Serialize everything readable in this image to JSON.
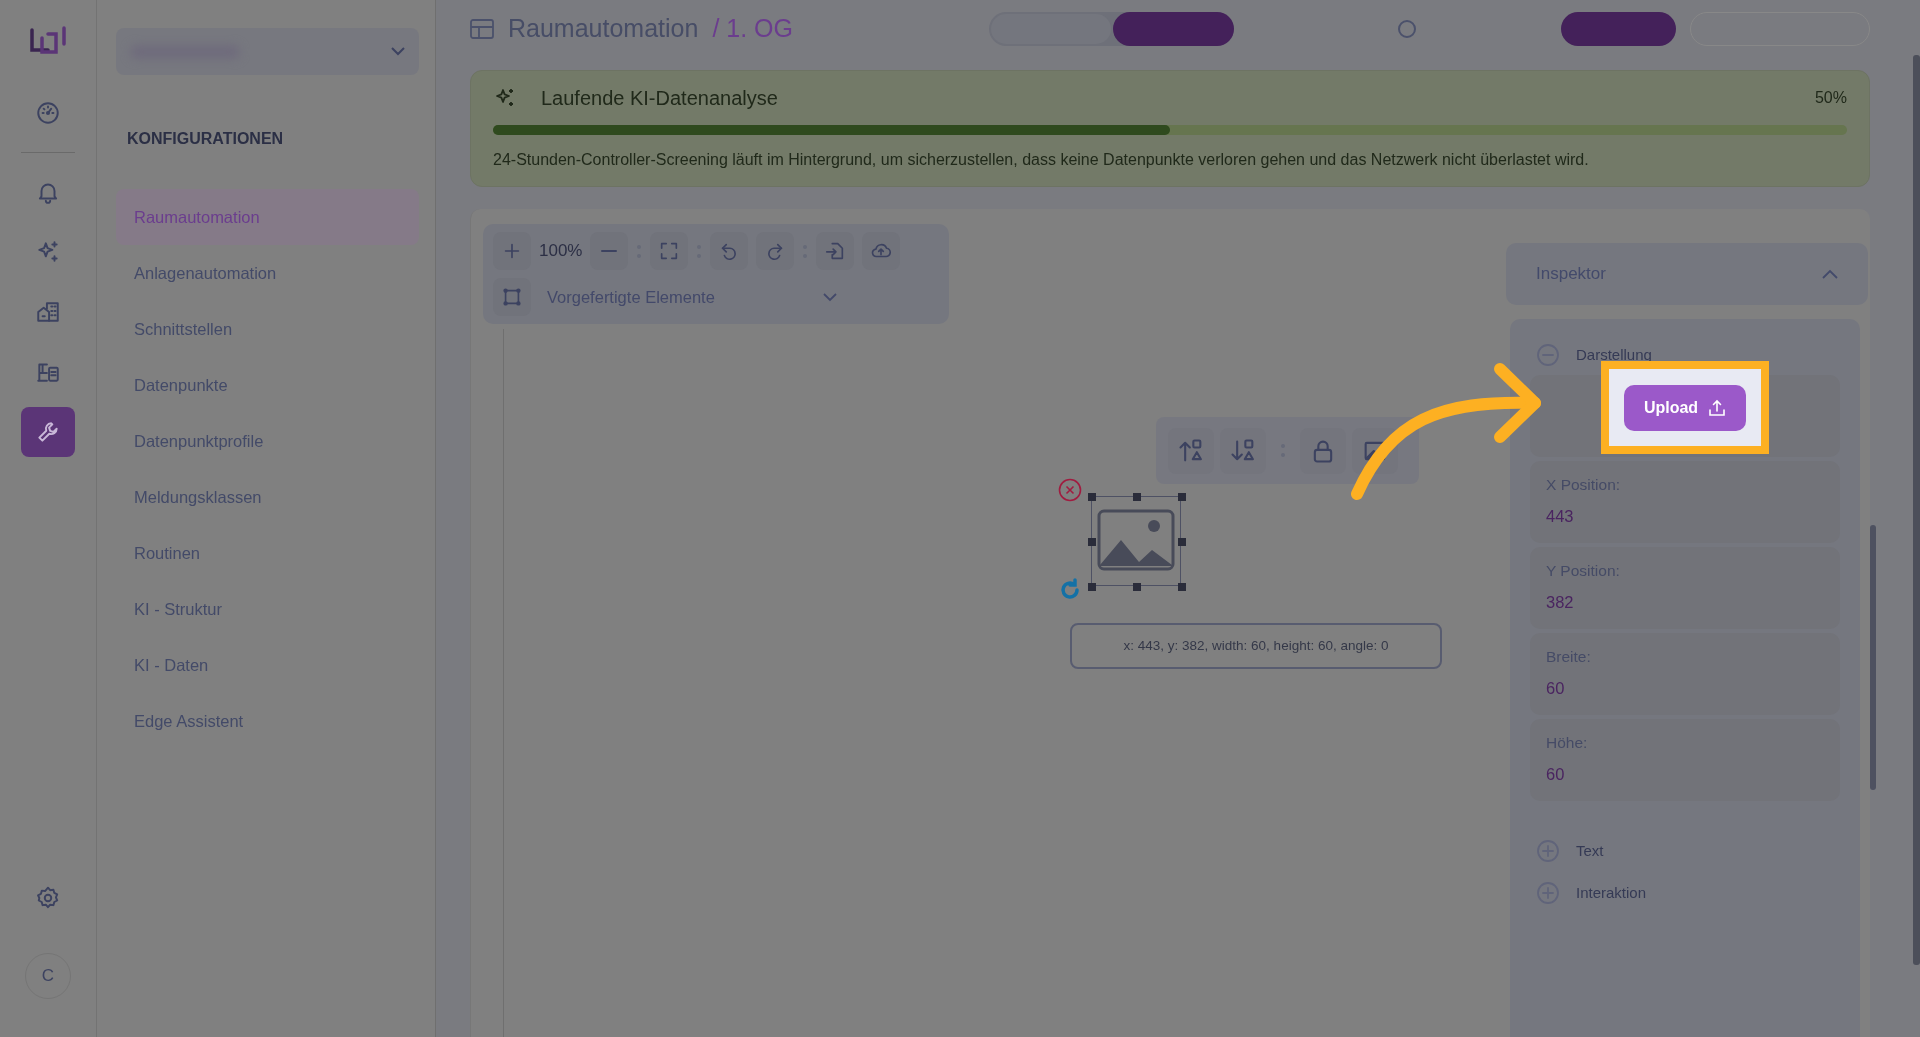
{
  "rail": {
    "items": [
      {
        "selected": false
      },
      {
        "selected": false
      },
      {
        "selected": false
      },
      {
        "selected": false
      },
      {
        "selected": false
      },
      {
        "selected": true
      }
    ],
    "avatar": "C"
  },
  "sidebar": {
    "heading": "KONFIGURATIONEN",
    "items": [
      {
        "label": "Raumautomation",
        "selected": true
      },
      {
        "label": "Anlagenautomation",
        "selected": false
      },
      {
        "label": "Schnittstellen",
        "selected": false
      },
      {
        "label": "Datenpunkte",
        "selected": false
      },
      {
        "label": "Datenpunktprofile",
        "selected": false
      },
      {
        "label": "Meldungsklassen",
        "selected": false
      },
      {
        "label": "Routinen",
        "selected": false
      },
      {
        "label": "KI - Struktur",
        "selected": false
      },
      {
        "label": "KI - Daten",
        "selected": false
      },
      {
        "label": "Edge Assistent",
        "selected": false
      }
    ]
  },
  "header": {
    "title": "Raumautomation",
    "subtitle": "/ 1. OG",
    "segments": [
      {
        "selected": false
      },
      {
        "selected": true
      }
    ]
  },
  "banner": {
    "title": "Laufende KI-Datenanalyse",
    "percent": "50%",
    "level": 0.5,
    "message": "24-Stunden-Controller-Screening läuft im Hintergrund, um sicherzustellen, dass keine Datenpunkte verloren gehen und das Netzwerk nicht überlastet wird."
  },
  "toolbar": {
    "zoom": "100%",
    "dropdown": "Vorgefertigte Elemente"
  },
  "selection_info": "x: 443, y: 382, width: 60, height: 60, angle: 0",
  "inspector": {
    "title": "Inspektor",
    "expanded": true,
    "upload_button": "Upload",
    "sections": [
      {
        "label": "Darstellung",
        "expanded": true
      },
      {
        "label": "Text",
        "expanded": false
      },
      {
        "label": "Interaktion",
        "expanded": false
      }
    ],
    "fields": [
      {
        "label": "X Position:",
        "value": "443"
      },
      {
        "label": "Y Position:",
        "value": "382"
      },
      {
        "label": "Breite:",
        "value": "60"
      },
      {
        "label": "Höhe:",
        "value": "60"
      }
    ]
  }
}
